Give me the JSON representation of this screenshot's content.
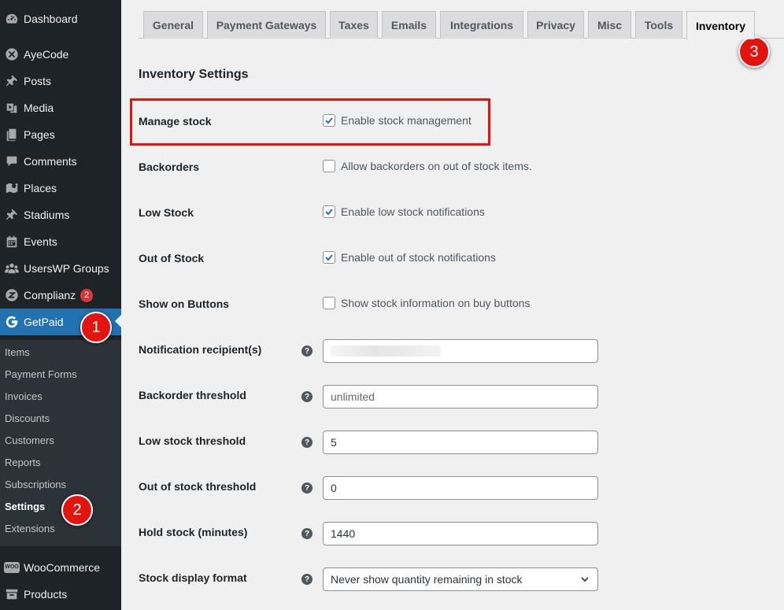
{
  "sidebar": {
    "items": [
      {
        "label": "Dashboard",
        "icon": "dashboard-icon"
      },
      {
        "label": "AyeCode",
        "icon": "ayecode-icon"
      },
      {
        "label": "Posts",
        "icon": "pin-icon"
      },
      {
        "label": "Media",
        "icon": "media-icon"
      },
      {
        "label": "Pages",
        "icon": "pages-icon"
      },
      {
        "label": "Comments",
        "icon": "comment-icon"
      },
      {
        "label": "Places",
        "icon": "map-icon"
      },
      {
        "label": "Stadiums",
        "icon": "pin-icon"
      },
      {
        "label": "Events",
        "icon": "calendar-icon"
      },
      {
        "label": "UsersWP Groups",
        "icon": "groups-icon"
      },
      {
        "label": "Complianz",
        "icon": "complianz-icon",
        "badge": "2"
      },
      {
        "label": "GetPaid",
        "icon": "getpaid-icon"
      },
      {
        "label": "WooCommerce",
        "icon": "woo-icon"
      },
      {
        "label": "Products",
        "icon": "archive-icon"
      }
    ],
    "submenu": [
      "Items",
      "Payment Forms",
      "Invoices",
      "Discounts",
      "Customers",
      "Reports",
      "Subscriptions",
      "Settings",
      "Extensions"
    ],
    "woo_icon_text": "WOO"
  },
  "callouts": [
    "1",
    "2",
    "3"
  ],
  "tabs": [
    "General",
    "Payment Gateways",
    "Taxes",
    "Emails",
    "Integrations",
    "Privacy",
    "Misc",
    "Tools",
    "Inventory"
  ],
  "heading": "Inventory Settings",
  "checkbox_fields": [
    {
      "label": "Manage stock",
      "text": "Enable stock management",
      "checked": true
    },
    {
      "label": "Backorders",
      "text": "Allow backorders on out of stock items.",
      "checked": false
    },
    {
      "label": "Low Stock",
      "text": "Enable low stock notifications",
      "checked": true
    },
    {
      "label": "Out of Stock",
      "text": "Enable out of stock notifications",
      "checked": true
    },
    {
      "label": "Show on Buttons",
      "text": "Show stock information on buy buttons",
      "checked": false
    }
  ],
  "input_fields": [
    {
      "label": "Notification recipient(s)",
      "value": ""
    },
    {
      "label": "Backorder threshold",
      "placeholder": "unlimited"
    },
    {
      "label": "Low stock threshold",
      "value": "5"
    },
    {
      "label": "Out of stock threshold",
      "value": "0"
    },
    {
      "label": "Hold stock (minutes)",
      "value": "1440"
    }
  ],
  "select_field": {
    "label": "Stock display format",
    "value": "Never show quantity remaining in stock"
  },
  "help_glyph": "?",
  "colors": {
    "sidebar": "#1d2327",
    "current": "#2271b1",
    "callout": "#e3140d",
    "checkbox": "#2271b1"
  }
}
